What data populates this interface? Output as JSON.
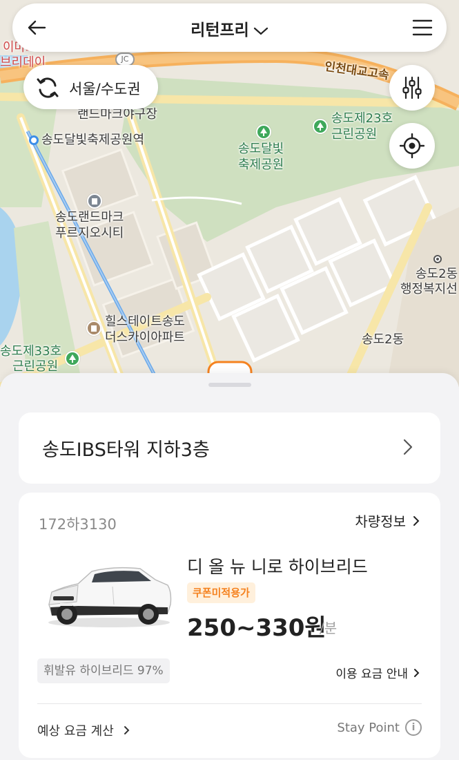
{
  "header": {
    "title": "리턴프리",
    "back_icon": "arrow-left-icon",
    "menu_icon": "hamburger-menu-icon"
  },
  "region": {
    "label": "서울/수도권",
    "icon": "refresh-icon"
  },
  "map": {
    "labels": {
      "imart": "이마트",
      "hybrid": "브리데이",
      "landmark": "랜드마크야구장",
      "station": "송도달빛축제공원역",
      "park_dalbit_1": "송도달빛",
      "park_dalbit_2": "축제공원",
      "park23_1": "송도제23호",
      "park23_2": "근린공원",
      "landmark_city_1": "송도랜드마크",
      "landmark_city_2": "푸르지오시티",
      "hillstate_1": "힐스테이트송도",
      "hillstate_2": "더스카이아파트",
      "park33_1": "송도제33호",
      "park33_2": "근린공원",
      "songdo2_1": "송도2동",
      "songdo2_2": "행정복지선",
      "songdo2_dong": "송도2동",
      "bridge_road": "인천대교고속",
      "jc": "JC"
    },
    "controls": {
      "filter_icon": "filter-sliders-icon",
      "location_icon": "my-location-icon"
    }
  },
  "location_card": {
    "name": "송도IBS타워 지하3층"
  },
  "car": {
    "plate": "172하3130",
    "info_button": "차량정보",
    "model": "디 올 뉴 니로 하이브리드",
    "coupon_badge": "쿠폰미적용가",
    "price": "250~330원",
    "price_unit": "/분",
    "fuel": "휘발유 하이브리드 97%",
    "fee_guide": "이용 요금 안내",
    "estimate": "예상 요금 계산",
    "stay_point": "Stay Point",
    "accent_color": "#f5821f"
  }
}
